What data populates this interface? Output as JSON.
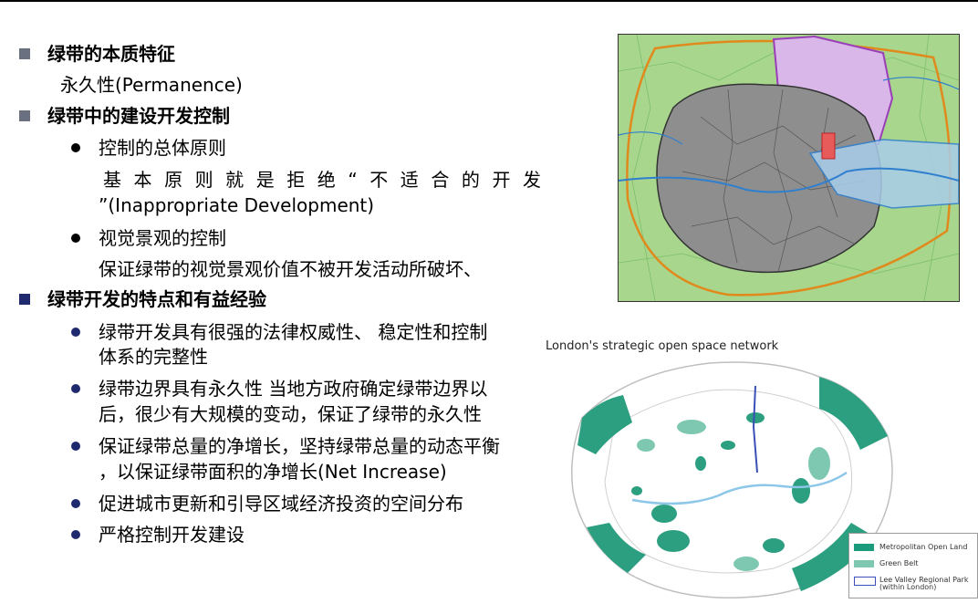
{
  "slide": {
    "heading1": "绿带的本质特征",
    "heading1_text": "永久性(Permanence)",
    "heading2": "绿带中的建设开发控制",
    "sub1_title": "控制的总体原则",
    "sub1_text_line1": "基本原则就是拒绝“不适合的开发",
    "sub1_text_line2": "”(Inappropriate Development)",
    "sub2_title": "视觉景观的控制",
    "sub2_text": "保证绿带的视觉景观价值不被开发活动所破坏、",
    "heading3": "绿带开发的特点和有益经验",
    "bullets": [
      {
        "line1": "绿带开发具有很强的法律权威性、 稳定性和控制",
        "line2": "体系的完整性"
      },
      {
        "line1": "绿带边界具有永久性 当地方政府确定绿带边界以",
        "line2": "后，很少有大规模的变动，保证了绿带的永久性"
      },
      {
        "line1": "保证绿带总量的净增长，坚持绿带总量的动态平衡",
        "line2": "，以保证绿带面积的净增长(Net Increase)"
      },
      {
        "line1": "促进城市更新和引导区域经济投资的空间分布",
        "line2": ""
      },
      {
        "line1": "严格控制开发建设",
        "line2": ""
      }
    ]
  },
  "map2": {
    "title": "London's strategic open space network",
    "legend": [
      {
        "label": "Metropolitan Open Land",
        "color": "#1a9b7c"
      },
      {
        "label": "Green Belt",
        "color": "#7ec8b2"
      },
      {
        "label": "Lee Valley Regional Park",
        "label2": "(within London)",
        "color": "#ffffff"
      }
    ]
  }
}
